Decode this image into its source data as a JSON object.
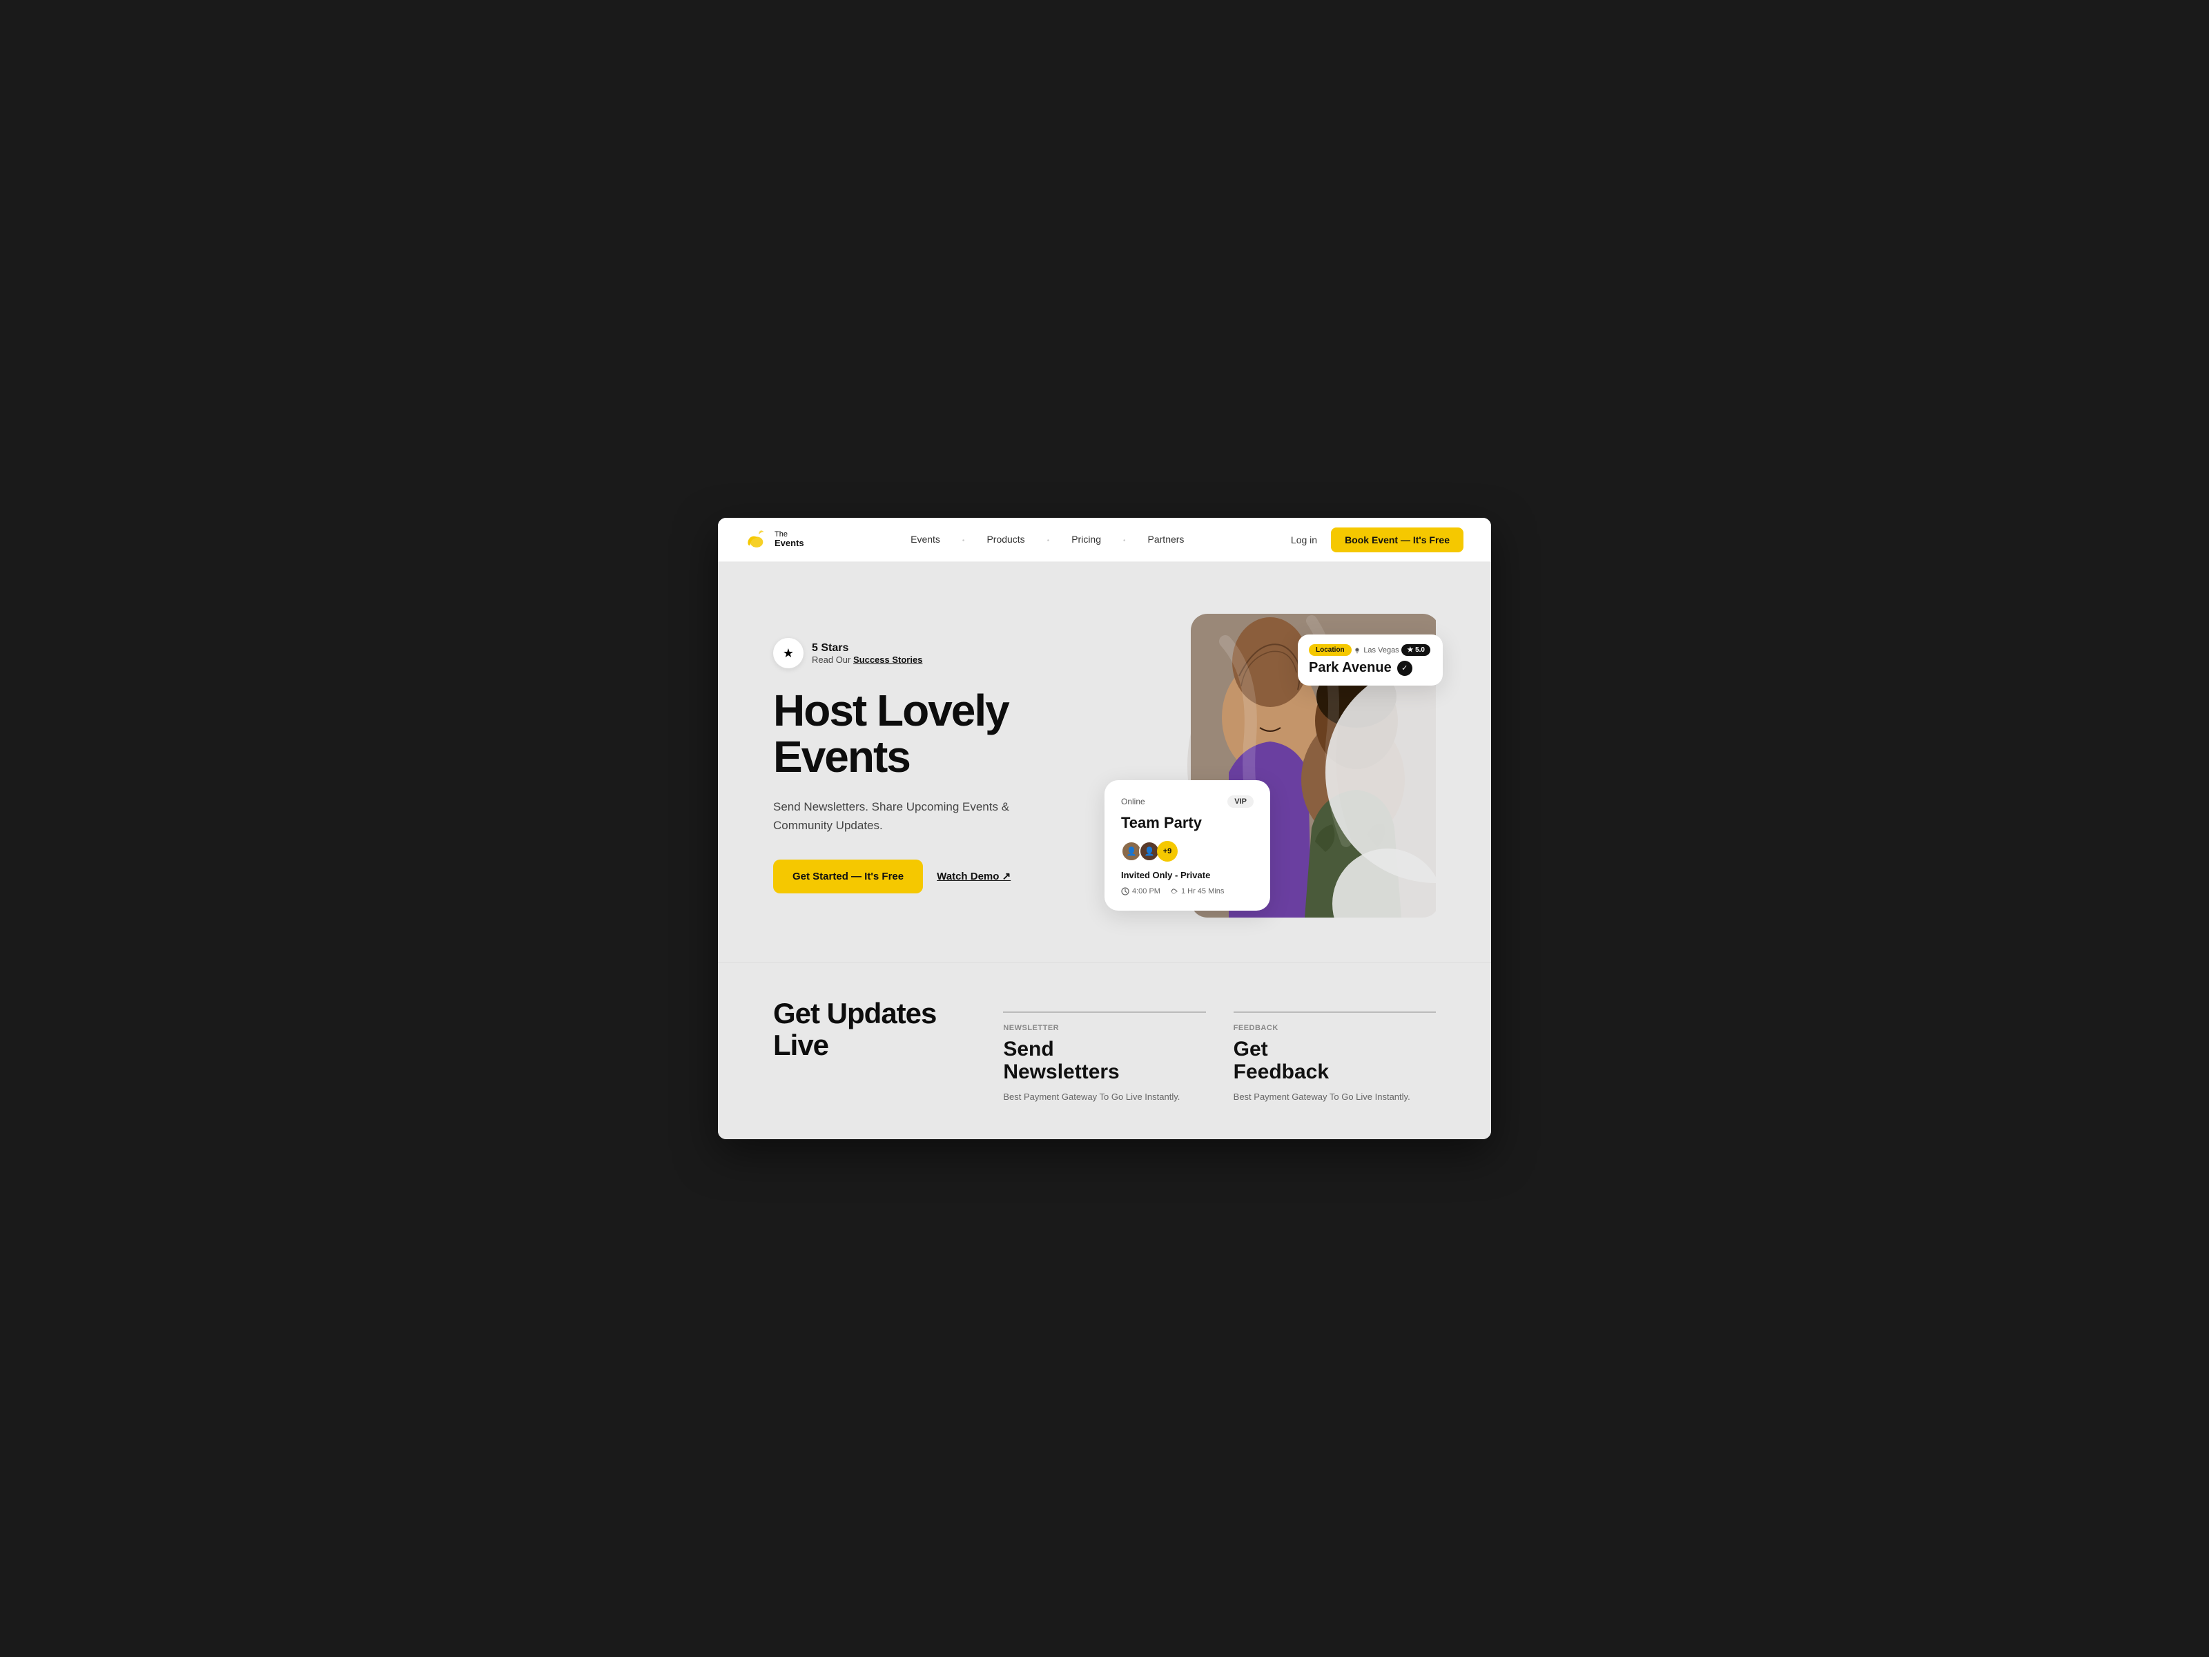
{
  "brand": {
    "name_line1": "The",
    "name_line2": "Events",
    "logo_emoji": "🌙"
  },
  "nav": {
    "links": [
      {
        "label": "Events",
        "id": "events"
      },
      {
        "label": "Products",
        "id": "products"
      },
      {
        "label": "Pricing",
        "id": "pricing"
      },
      {
        "label": "Partners",
        "id": "partners"
      }
    ],
    "login_label": "Log in",
    "book_label": "Book Event — It's Free"
  },
  "hero": {
    "stars_count": "5 Stars",
    "stars_sub": "Read Our ",
    "stars_link": "Success Stories",
    "title_line1": "Host Lovely",
    "title_line2": "Events",
    "subtitle": "Send Newsletters. Share Upcoming Events & Community Updates.",
    "cta_primary": "Get Started — It's Free",
    "cta_secondary": "Watch Demo ↗"
  },
  "event_card": {
    "badge_online": "Online",
    "badge_vip": "VIP",
    "title": "Team Party",
    "avatar_plus": "+9",
    "private_label": "Invited Only - Private",
    "time": "4:00 PM",
    "duration": "1 Hr 45 Mins"
  },
  "location_card": {
    "label": "Location",
    "city": "Las Vegas",
    "rating": "★ 5.0",
    "name": "Park Avenue"
  },
  "bottom": {
    "section_title_line1": "Get Updates",
    "section_title_line2": "Live",
    "feature1": {
      "label": "Newsletter",
      "title_line1": "Send",
      "title_line2": "Newsletters",
      "desc": "Best Payment Gateway To Go Live Instantly."
    },
    "feature2": {
      "label": "Feedback",
      "title_line1": "Get",
      "title_line2": "Feedback",
      "desc": "Best Payment Gateway To Go Live Instantly."
    }
  },
  "colors": {
    "yellow": "#f5c800",
    "dark": "#0d0d0d",
    "bg": "#e8e8e8"
  }
}
